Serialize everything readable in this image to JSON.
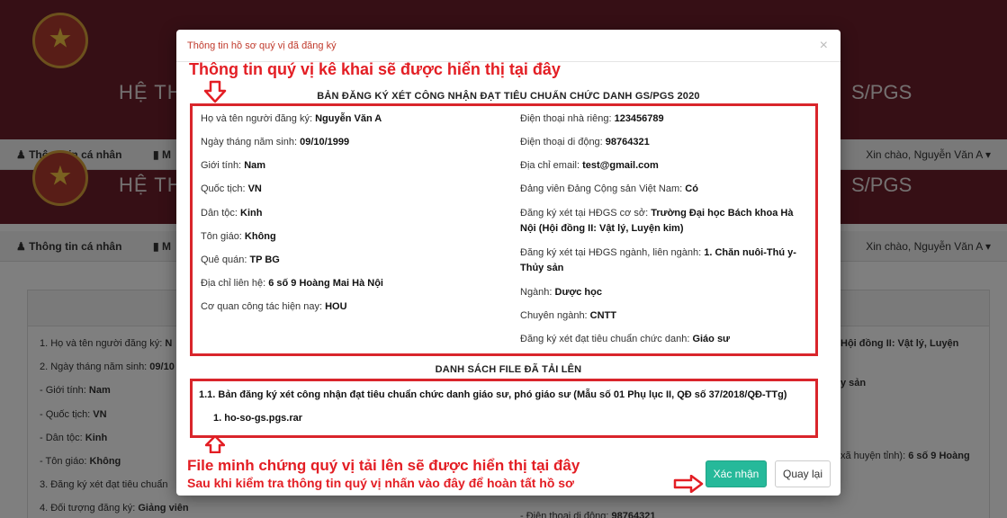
{
  "background": {
    "header_title": "HỆ TH",
    "header_suffix": "S/PGS",
    "nav": {
      "personal_info": "Thông tin cá nhân",
      "second_item": "M",
      "greeting": "Xin chào, Nguyễn Văn A"
    },
    "lines_left": [
      {
        "label": "1. Họ và tên người đăng ký: ",
        "value": "N"
      },
      {
        "label": "2. Ngày tháng năm sinh: ",
        "value": "09/10"
      },
      {
        "label": "- Giới tính: ",
        "value": "Nam"
      },
      {
        "label": "- Quốc tịch: ",
        "value": "VN"
      },
      {
        "label": "- Dân tộc: ",
        "value": "Kinh"
      },
      {
        "label": "- Tôn giáo: ",
        "value": "Không"
      },
      {
        "label": "3. Đăng ký xét đạt tiêu chuẩn",
        "value": ""
      },
      {
        "label": "4. Đối tượng đăng ký: ",
        "value": "Giảng viên"
      }
    ],
    "lines_right": [
      {
        "label": "",
        "value": "Hội đồng II: Vật lý, Luyện"
      },
      {
        "label": "",
        "value": "y sản"
      },
      {
        "label": "xã huyện tỉnh): ",
        "value": "6 số 9 Hoàng"
      },
      {
        "label": "- Điện thoại di động: ",
        "value": "98764321"
      }
    ]
  },
  "modal": {
    "title": "Thông tin hồ sơ quý vị đã đăng ký",
    "close": "×",
    "annotation_top": "Thông tin quý vị kê khai sẽ được hiển thị tại đây",
    "form_title": "BẢN ĐĂNG KÝ XÉT CÔNG NHẬN ĐẠT TIÊU CHUẨN CHỨC DANH GS/PGS 2020",
    "left_fields": [
      {
        "label": "Họ và tên người đăng ký: ",
        "value": "Nguyễn Văn A"
      },
      {
        "label": "Ngày tháng năm sinh: ",
        "value": "09/10/1999"
      },
      {
        "label": "Giới tính: ",
        "value": "Nam"
      },
      {
        "label": "Quốc tịch: ",
        "value": "VN"
      },
      {
        "label": "Dân tộc: ",
        "value": "Kinh"
      },
      {
        "label": "Tôn giáo: ",
        "value": "Không"
      },
      {
        "label": "Quê quán: ",
        "value": "TP BG"
      },
      {
        "label": "Địa chỉ liên hệ: ",
        "value": "6 số 9 Hoàng Mai Hà Nội"
      },
      {
        "label": "Cơ quan công tác hiện nay: ",
        "value": "HOU"
      }
    ],
    "right_fields": [
      {
        "label": "Điện thoại nhà riêng: ",
        "value": "123456789"
      },
      {
        "label": "Điện thoại di động: ",
        "value": "98764321"
      },
      {
        "label": "Địa chỉ email: ",
        "value": "test@gmail.com"
      },
      {
        "label": "Đảng viên Đảng Cộng sản Việt Nam: ",
        "value": "Có"
      },
      {
        "label": "Đăng ký xét tại HĐGS cơ sở: ",
        "value": "Trường Đại học Bách khoa Hà Nội (Hội đồng II: Vật lý, Luyện kim)"
      },
      {
        "label": "Đăng ký xét tại HĐGS ngành, liên ngành: ",
        "value": "1. Chăn nuôi-Thú y-Thủy sản"
      },
      {
        "label": "Ngành: ",
        "value": "Dược học"
      },
      {
        "label": "Chuyên ngành: ",
        "value": "CNTT"
      },
      {
        "label": "Đăng ký xét đạt tiêu chuẩn chức danh: ",
        "value": "Giáo sư"
      }
    ],
    "files_title": "DANH SÁCH FILE ĐÃ TẢI LÊN",
    "file_group": "1.1. Bản đăng ký xét công nhận đạt tiêu chuẩn chức danh giáo sư, phó giáo sư (Mẫu số 01 Phụ lục II, QĐ số 37/2018/QĐ-TTg)",
    "file_item": "1. ho-so-gs.pgs.rar",
    "annotation_files": "File minh chứng quý vị tải lên sẽ được hiển thị tại đây",
    "annotation_confirm": "Sau khi kiểm tra thông tin quý vị nhấn vào đây để hoàn tất hồ sơ",
    "confirm_label": "Xác nhận",
    "back_label": "Quay lại"
  },
  "colors": {
    "banner": "#6d1f2a",
    "annotation_red": "#e31e24",
    "confirm_green": "#26b99a"
  }
}
